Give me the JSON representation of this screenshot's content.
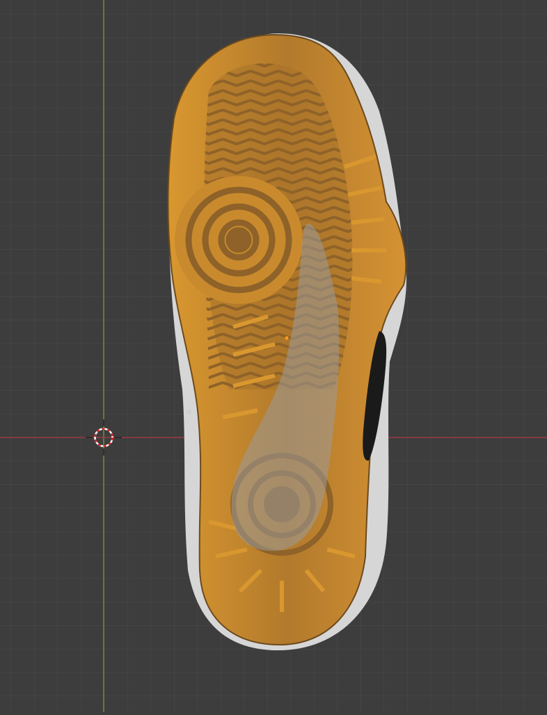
{
  "viewport": {
    "name": "3D Viewport",
    "object": "shoe-sole-model",
    "colors": {
      "background": "#3d3d3d",
      "grid": "#4a4a4a",
      "x_axis": "#9b3a45",
      "y_axis": "#6f8f2f",
      "sole": "#c98a2e",
      "sole_dark": "#a8732a",
      "upper": "#d9d9d9",
      "swoosh": "#8d8478",
      "cursor_red": "#d22",
      "origin": "#ff9a1f"
    }
  }
}
